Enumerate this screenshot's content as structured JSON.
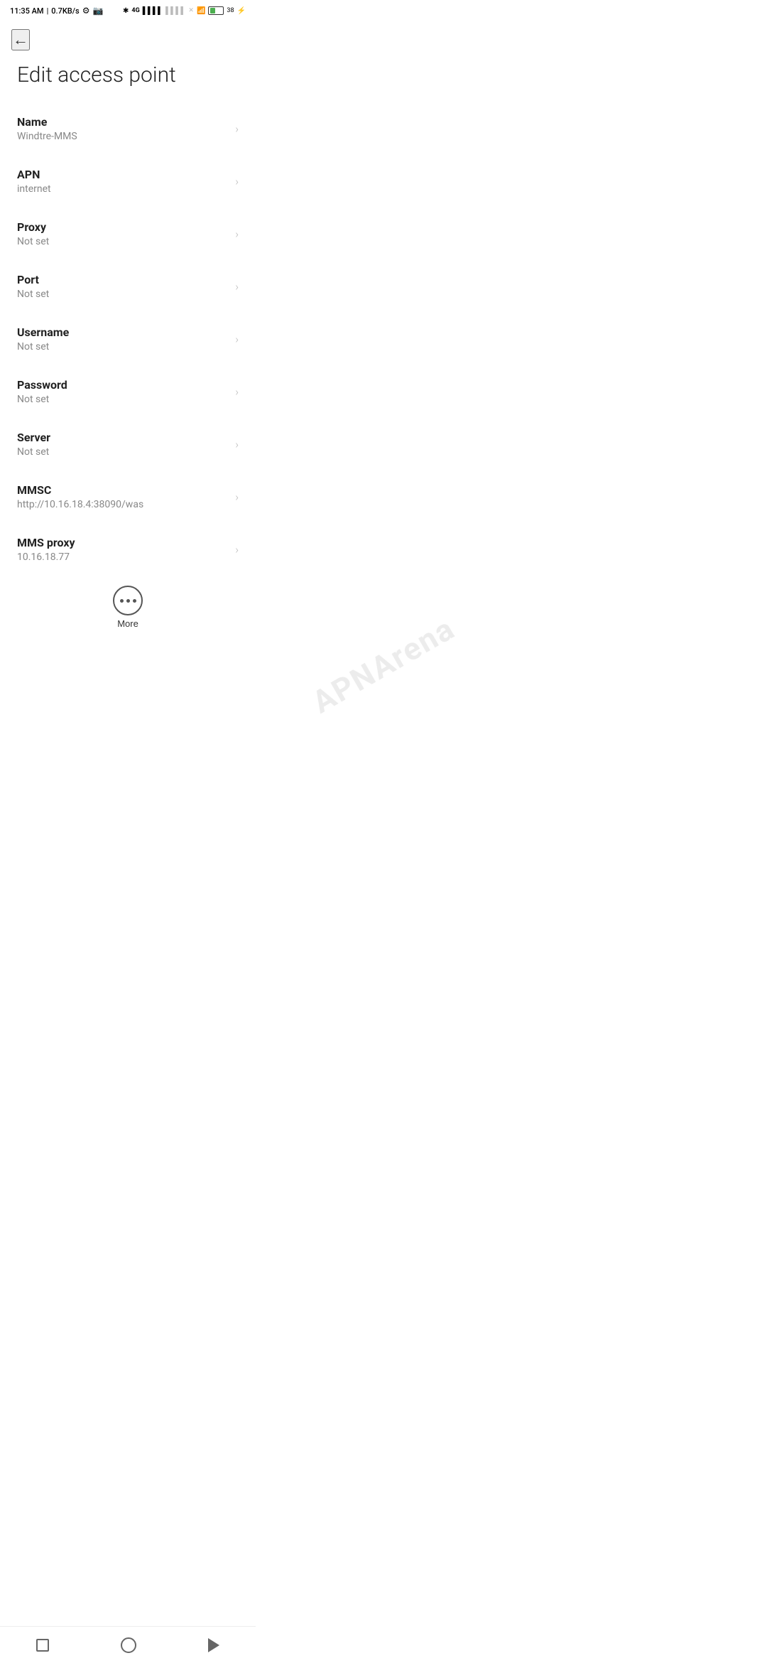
{
  "status_bar": {
    "time": "11:35 AM",
    "network_speed": "0.7KB/s"
  },
  "toolbar": {
    "back_label": "←"
  },
  "page": {
    "title": "Edit access point"
  },
  "settings_items": [
    {
      "label": "Name",
      "value": "Windtre-MMS"
    },
    {
      "label": "APN",
      "value": "internet"
    },
    {
      "label": "Proxy",
      "value": "Not set"
    },
    {
      "label": "Port",
      "value": "Not set"
    },
    {
      "label": "Username",
      "value": "Not set"
    },
    {
      "label": "Password",
      "value": "Not set"
    },
    {
      "label": "Server",
      "value": "Not set"
    },
    {
      "label": "MMSC",
      "value": "http://10.16.18.4:38090/was"
    },
    {
      "label": "MMS proxy",
      "value": "10.16.18.77"
    }
  ],
  "more_button": {
    "label": "More"
  },
  "bottom_nav": {
    "recents_label": "recents",
    "home_label": "home",
    "back_label": "back"
  },
  "watermark": {
    "text": "APNArena"
  }
}
